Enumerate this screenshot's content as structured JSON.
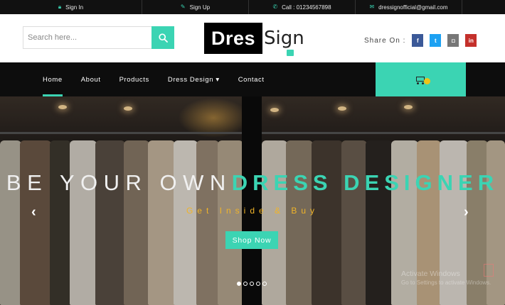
{
  "topbar": {
    "items": [
      {
        "label": "Sign In",
        "icon": "lock-icon"
      },
      {
        "label": "Sign Up",
        "icon": "edit-icon"
      },
      {
        "label": "Call : 01234567898",
        "icon": "phone-icon"
      },
      {
        "label": "dressignofficial@gmail.com",
        "icon": "mail-icon"
      }
    ]
  },
  "header": {
    "search_placeholder": "Search here...",
    "logo_dark": "Dres",
    "logo_light": "Sign",
    "share_label": "Share On :",
    "social": [
      {
        "name": "facebook-icon",
        "glyph": "f",
        "color": "#3b5998"
      },
      {
        "name": "twitter-icon",
        "glyph": "t",
        "color": "#1da1f2"
      },
      {
        "name": "instagram-icon",
        "glyph": "◘",
        "color": "#777777"
      },
      {
        "name": "linkedin-icon",
        "glyph": "in",
        "color": "#c4302b"
      }
    ]
  },
  "nav": {
    "items": [
      "Home",
      "About",
      "Products",
      "Dress Design ▾",
      "Contact"
    ],
    "active": "Home"
  },
  "hero": {
    "headline_light": "BE YOUR OWN",
    "headline_accent": "DRESS DESIGNER",
    "tagline": "Get Inside & Buy",
    "cta": "Shop Now",
    "prev": "‹",
    "next": "›",
    "slides": 5,
    "current_slide": 1
  },
  "watermark": {
    "line1": "Activate Windows",
    "line2": "Go to Settings to activate Windows."
  },
  "colors": {
    "accent": "#3bd4b3",
    "tagline": "#f0b429",
    "dark": "#0d0d0d"
  }
}
